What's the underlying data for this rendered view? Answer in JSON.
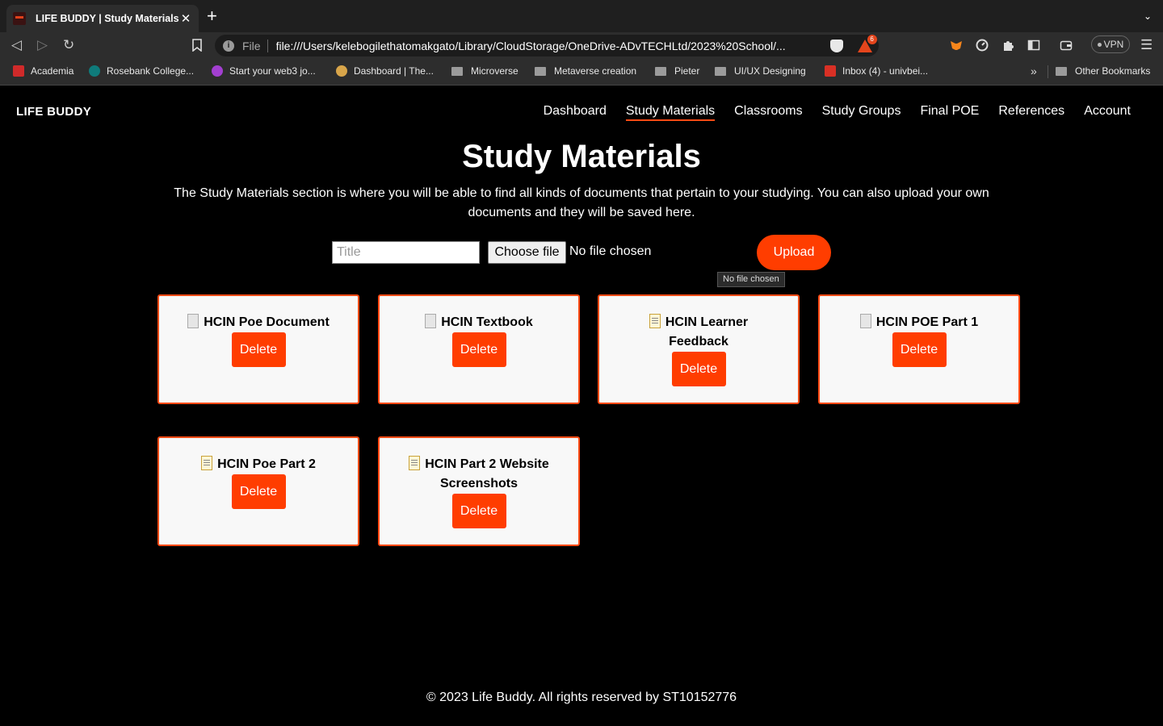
{
  "browser": {
    "tab_title": "LIFE BUDDY | Study Materials",
    "tab_close": "✕",
    "new_tab": "+",
    "tab_menu": "⌄",
    "url_scheme": "File",
    "url": "file:///Users/kelebogilethatomakgato/Library/CloudStorage/OneDrive-ADvTECHLtd/2023%20School/...",
    "rewards_badge": "6",
    "vpn_label": "VPN",
    "bookmarks": [
      {
        "label": "Academia",
        "icon": "academia-icon",
        "color": "#d02a2a"
      },
      {
        "label": "Rosebank College...",
        "icon": "sharepoint-icon",
        "color": "#0f7b7b"
      },
      {
        "label": "Start your web3 jo...",
        "icon": "crystal-ball-icon",
        "color": "#a33fd1"
      },
      {
        "label": "Dashboard | The...",
        "icon": "owl-icon",
        "color": "#d8a54a"
      },
      {
        "label": "Microverse",
        "icon": "folder-icon"
      },
      {
        "label": "Metaverse creation",
        "icon": "folder-icon"
      },
      {
        "label": "Pieter",
        "icon": "folder-icon"
      },
      {
        "label": "UI/UX Designing",
        "icon": "folder-icon"
      },
      {
        "label": "Inbox (4) - univbei...",
        "icon": "gmail-icon",
        "color": "#d93025"
      }
    ],
    "more_bookmarks": "»",
    "other_bookmarks": "Other Bookmarks"
  },
  "site": {
    "brand": "LIFE BUDDY",
    "nav": [
      "Dashboard",
      "Study Materials",
      "Classrooms",
      "Study Groups",
      "Final POE",
      "References",
      "Account"
    ],
    "active_nav": "Study Materials"
  },
  "main": {
    "title": "Study Materials",
    "intro": "The Study Materials section is where you will be able to find all kinds of documents that pertain to your studying. You can also upload your own documents and they will be saved here.",
    "title_placeholder": "Title",
    "choose_file": "Choose file",
    "file_status": "No file chosen",
    "upload": "Upload",
    "tooltip": "No file chosen",
    "documents": [
      {
        "title": "HCIN Poe Document",
        "icon": "document-icon"
      },
      {
        "title": "HCIN Textbook",
        "icon": "document-icon"
      },
      {
        "title": "HCIN Learner Feedback",
        "icon": "memo-icon"
      },
      {
        "title": "HCIN POE Part 1",
        "icon": "document-icon"
      },
      {
        "title": "HCIN Poe Part 2",
        "icon": "memo-icon"
      },
      {
        "title": "HCIN Part 2 Website Screenshots",
        "icon": "memo-icon"
      }
    ],
    "delete_label": "Delete"
  },
  "footer": "© 2023 Life Buddy. All rights reserved by ST10152776",
  "colors": {
    "accent": "#ff3d00",
    "card_border": "#ff4a14",
    "page_bg": "#000000",
    "card_bg": "#f8f8f8"
  }
}
